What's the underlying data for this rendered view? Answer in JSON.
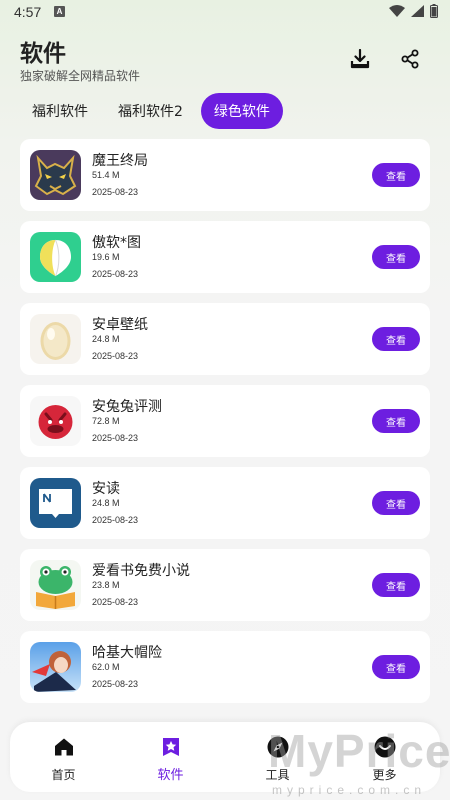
{
  "status_bar": {
    "time": "4:57",
    "notification_letter": "A"
  },
  "header": {
    "title": "软件",
    "subtitle": "独家破解全网精品软件",
    "download_icon": "download-tray-icon",
    "share_icon": "share-icon"
  },
  "tabs": [
    {
      "label": "福利软件",
      "active": false
    },
    {
      "label": "福利软件2",
      "active": false
    },
    {
      "label": "绿色软件",
      "active": true
    }
  ],
  "apps": [
    {
      "name": "魔王终局",
      "size": "51.4 M",
      "date": "2025-08-23",
      "button": "查看",
      "icon": "demon-king-icon"
    },
    {
      "name": "傲软*图",
      "size": "19.6 M",
      "date": "2025-08-23",
      "button": "查看",
      "icon": "green-shield-icon"
    },
    {
      "name": "安卓壁纸",
      "size": "24.8 M",
      "date": "2025-08-23",
      "button": "查看",
      "icon": "egg-icon"
    },
    {
      "name": "安兔兔评测",
      "size": "72.8 M",
      "date": "2025-08-23",
      "button": "查看",
      "icon": "antutu-icon"
    },
    {
      "name": "安读",
      "size": "24.8 M",
      "date": "2025-08-23",
      "button": "查看",
      "icon": "book-chat-icon"
    },
    {
      "name": "爱看书免费小说",
      "size": "23.8 M",
      "date": "2025-08-23",
      "button": "查看",
      "icon": "frog-book-icon"
    },
    {
      "name": "哈基大帽险",
      "size": "62.0 M",
      "date": "2025-08-23",
      "button": "查看",
      "icon": "anime-character-icon"
    }
  ],
  "bottom_nav": [
    {
      "label": "首页",
      "icon": "home-icon",
      "active": false
    },
    {
      "label": "软件",
      "icon": "star-badge-icon",
      "active": true
    },
    {
      "label": "工具",
      "icon": "compass-icon",
      "active": false
    },
    {
      "label": "更多",
      "icon": "more-face-icon",
      "active": false
    }
  ],
  "watermark": {
    "text": "MyPrice",
    "sub": "myprice.com.cn"
  },
  "colors": {
    "accent": "#6d1ee0",
    "card": "#ffffff",
    "background": "#f5f5f5"
  }
}
